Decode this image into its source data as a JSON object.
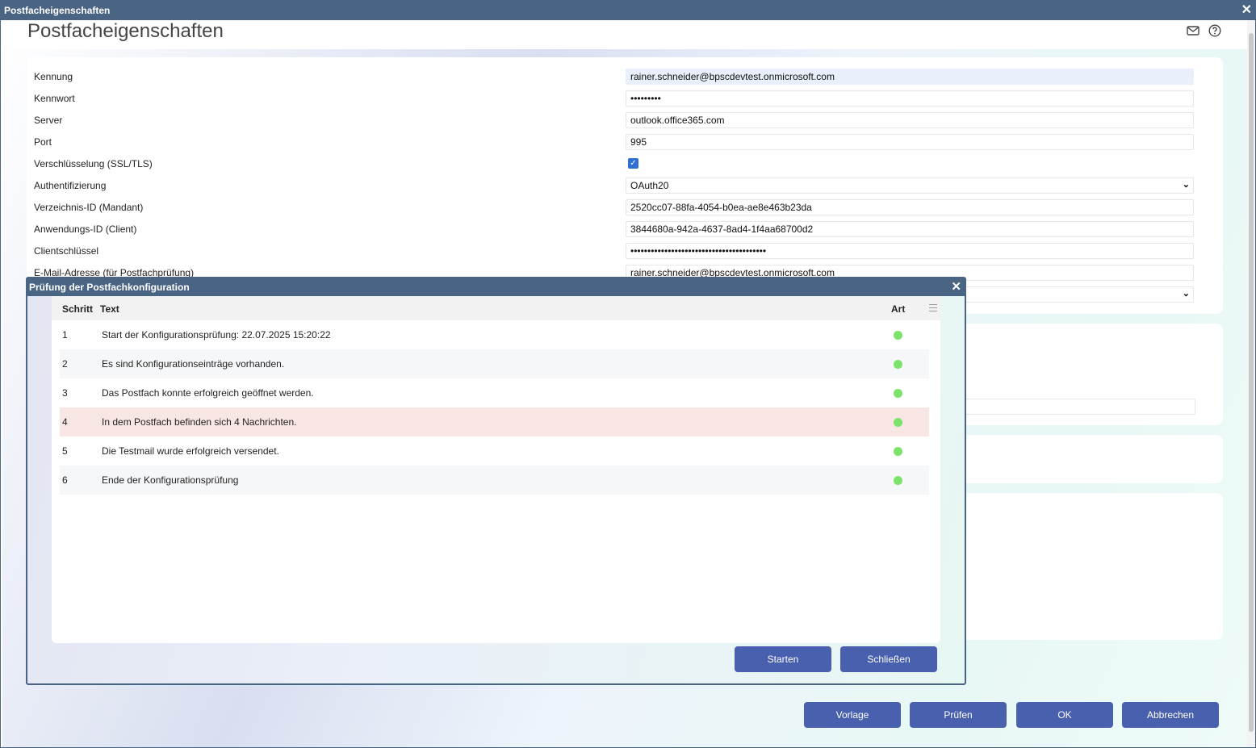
{
  "window": {
    "title": "Postfacheigenschaften"
  },
  "page": {
    "title": "Postfacheigenschaften"
  },
  "icons": {
    "mail": "mail-icon",
    "help": "help-icon",
    "close": "close-icon"
  },
  "form": {
    "rows": [
      {
        "label": "Kennung",
        "value": "rainer.schneider@bpscdevtest.onmicrosoft.com"
      },
      {
        "label": "Kennwort",
        "value": "•••••••••"
      },
      {
        "label": "Server",
        "value": "outlook.office365.com"
      },
      {
        "label": "Port",
        "value": "995"
      },
      {
        "label": "Verschlüsselung (SSL/TLS)",
        "value": ""
      },
      {
        "label": "Authentifizierung",
        "value": "OAuth20"
      },
      {
        "label": "Verzeichnis-ID (Mandant)",
        "value": "2520cc07-88fa-4054-b0ea-ae8e463b23da"
      },
      {
        "label": "Anwendungs-ID (Client)",
        "value": "3844680a-942a-4637-8ad4-1f4aa68700d2"
      },
      {
        "label": "Clientschlüssel",
        "value": "••••••••••••••••••••••••••••••••••••••••"
      },
      {
        "label": "E-Mail-Adresse (für Postfachprüfung)",
        "value": "rainer.schneider@bpscdevtest.onmicrosoft.com"
      }
    ],
    "encryption_checked": true
  },
  "footer": {
    "vorlage": "Vorlage",
    "pruefen": "Prüfen",
    "ok": "OK",
    "abbrechen": "Abbrechen"
  },
  "dialog": {
    "title": "Prüfung der Postfachkonfiguration",
    "columns": {
      "step": "Schritt",
      "text": "Text",
      "type": "Art"
    },
    "rows": [
      {
        "step": "1",
        "text": "Start der Konfigurationsprüfung: 22.07.2025 15:20:22",
        "status": "green"
      },
      {
        "step": "2",
        "text": "Es sind Konfigurationseinträge vorhanden.",
        "status": "green"
      },
      {
        "step": "3",
        "text": "Das Postfach konnte erfolgreich geöffnet werden.",
        "status": "green"
      },
      {
        "step": "4",
        "text": "In dem Postfach befinden sich 4 Nachrichten.",
        "status": "green"
      },
      {
        "step": "5",
        "text": "Die Testmail wurde erfolgreich versendet.",
        "status": "green"
      },
      {
        "step": "6",
        "text": "Ende der Konfigurationsprüfung",
        "status": "green"
      }
    ],
    "buttons": {
      "start": "Starten",
      "close": "Schließen"
    },
    "status_color": "#7be36a"
  }
}
